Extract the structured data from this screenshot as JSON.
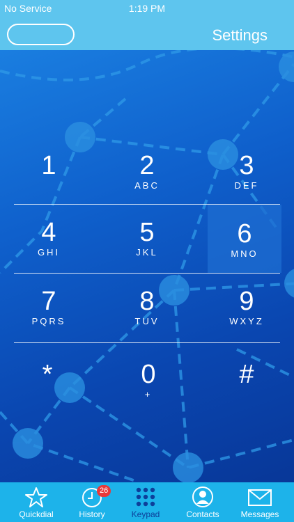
{
  "status_bar": {
    "carrier": "No Service",
    "time": "1:19 PM"
  },
  "nav_bar": {
    "number_field_value": "",
    "settings_label": "Settings"
  },
  "keypad": {
    "keys": [
      {
        "digit": "1",
        "letters": ""
      },
      {
        "digit": "2",
        "letters": "ABC"
      },
      {
        "digit": "3",
        "letters": "DEF"
      },
      {
        "digit": "4",
        "letters": "GHI"
      },
      {
        "digit": "5",
        "letters": "JKL"
      },
      {
        "digit": "6",
        "letters": "MNO"
      },
      {
        "digit": "7",
        "letters": "PQRS"
      },
      {
        "digit": "8",
        "letters": "TUV"
      },
      {
        "digit": "9",
        "letters": "WXYZ"
      },
      {
        "digit": "*",
        "letters": ""
      },
      {
        "digit": "0",
        "letters": "+"
      },
      {
        "digit": "#",
        "letters": ""
      }
    ]
  },
  "tab_bar": {
    "tabs": [
      {
        "label": "Quickdial",
        "icon": "star-icon"
      },
      {
        "label": "History",
        "icon": "clock-icon",
        "badge": "26"
      },
      {
        "label": "Keypad",
        "icon": "keypad-icon"
      },
      {
        "label": "Contacts",
        "icon": "contact-icon"
      },
      {
        "label": "Messages",
        "icon": "envelope-icon"
      }
    ],
    "selected": "Keypad"
  },
  "colors": {
    "bar_light_blue": "#5ec5ee",
    "tab_bar_blue": "#1db3ea",
    "selected_tab": "#0d3f9a",
    "badge_red": "#e8383a"
  }
}
